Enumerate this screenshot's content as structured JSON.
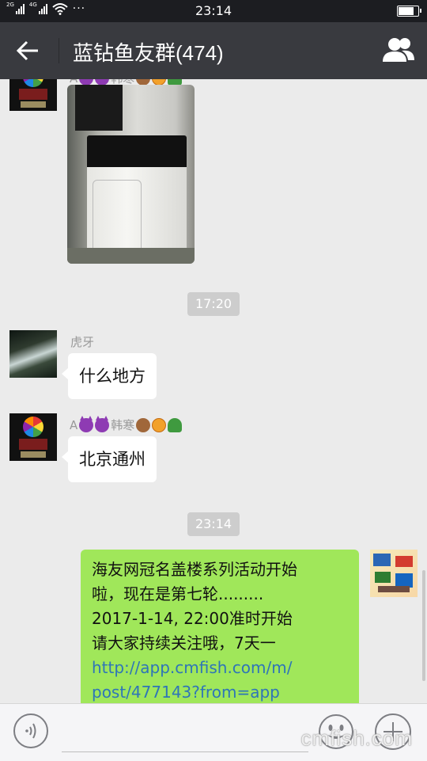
{
  "status_bar": {
    "network_1": "2G",
    "network_2": "4G",
    "time": "23:14",
    "more": "···",
    "battery_level": 0.85
  },
  "header": {
    "title": "蓝钻鱼友群(474)"
  },
  "messages": [
    {
      "type": "image",
      "sender": "A👿👿韩寒🐒🐯🐍",
      "direction": "in",
      "avatar": "fortune-wheel-avatar",
      "image_desc": "photo"
    },
    {
      "type": "timestamp",
      "text": "17:20"
    },
    {
      "type": "text",
      "sender": "虎牙",
      "direction": "in",
      "avatar": "waterfall-avatar",
      "text": "什么地方"
    },
    {
      "type": "text",
      "sender_prefix": "A",
      "sender_name": "韩寒",
      "direction": "in",
      "avatar": "fortune-wheel-avatar",
      "text": "北京通州"
    },
    {
      "type": "timestamp",
      "text": "23:14"
    },
    {
      "type": "text",
      "direction": "out",
      "avatar": "collage-avatar",
      "lines": [
        "海友网冠名盖楼系列活动开始",
        "啦，现在是第七轮.........",
        "2017-1-14, 22:00准时开始",
        "请大家持续关注哦，7天一"
      ],
      "link_lines": [
        "http://app.cmfish.com/m/",
        "post/477143?from=app"
      ]
    }
  ],
  "input_bar": {
    "watermark": "cmfish.com"
  },
  "colors": {
    "header_bg": "#393a3f",
    "chat_bg": "#ebebeb",
    "bubble_out": "#a0e75a",
    "bubble_in": "#ffffff",
    "link": "#2e75b8"
  }
}
